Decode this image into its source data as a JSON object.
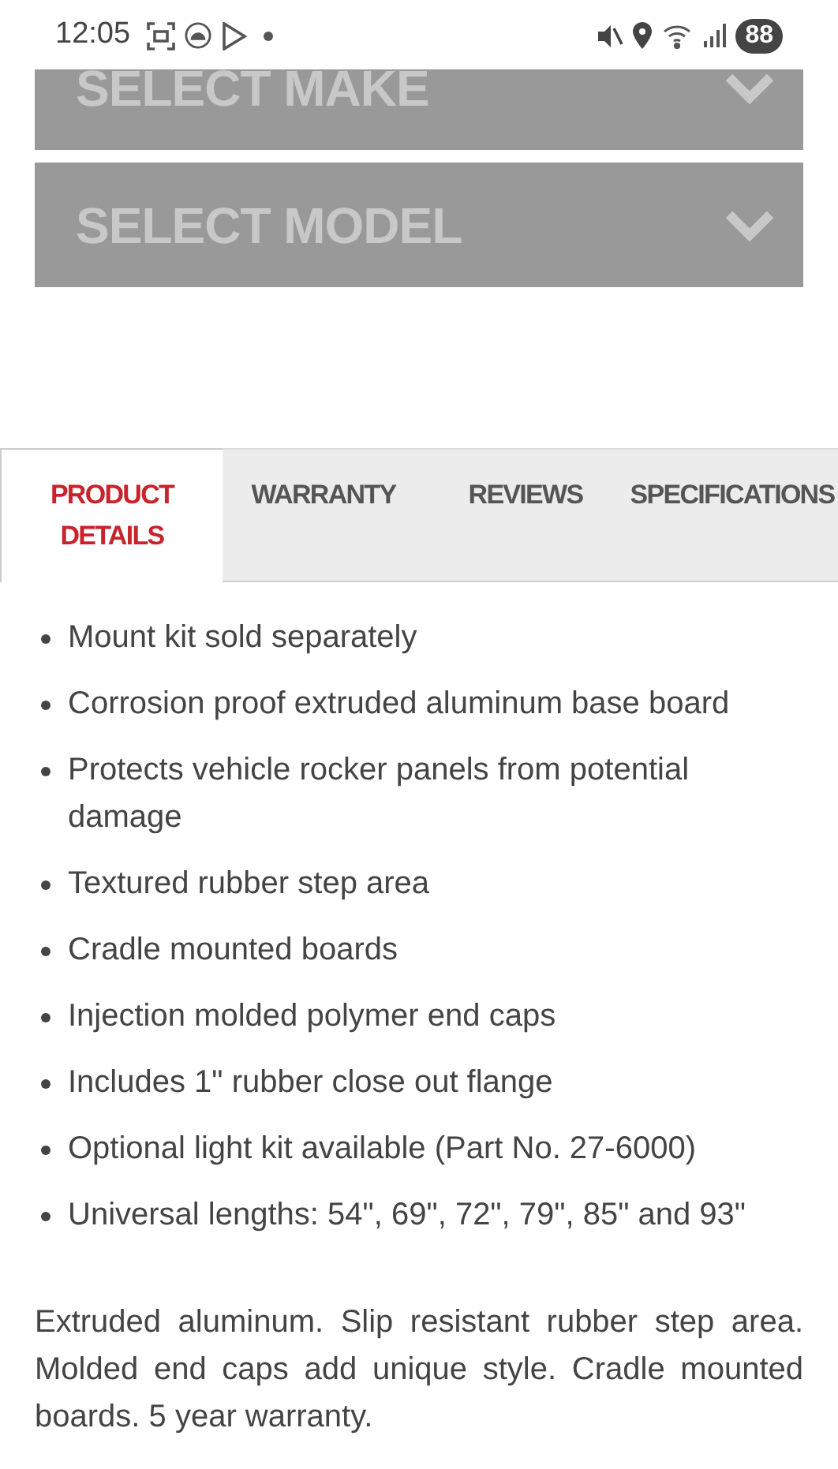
{
  "status_bar": {
    "time": "12:05",
    "battery": "88"
  },
  "selects": [
    {
      "label": "SELECT MAKE"
    },
    {
      "label": "SELECT MODEL"
    }
  ],
  "tabs": [
    {
      "label": "PRODUCT DETAILS",
      "selected": true
    },
    {
      "label": "WARRANTY",
      "selected": false
    },
    {
      "label": "REVIEWS",
      "selected": false
    },
    {
      "label": "SPECIFICATIONS",
      "selected": false
    }
  ],
  "features": [
    "Mount kit sold separately",
    "Corrosion proof extruded aluminum base board",
    "Protects vehicle rocker panels from potential damage",
    "Textured rubber step area",
    "Cradle mounted boards",
    "Injection molded polymer end caps",
    "Includes 1\" rubber close out flange",
    "Optional light kit available (Part No. 27-6000)",
    "Universal lengths: 54\", 69\", 72\", 79\", 85\" and 93\""
  ],
  "description": "Extruded aluminum. Slip resistant rubber step area. Molded end caps add unique style. Cradle mounted boards. 5 year warranty."
}
